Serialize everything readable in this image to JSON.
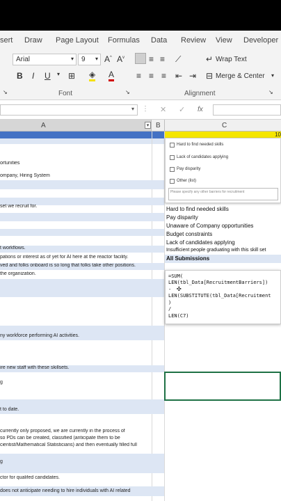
{
  "ribbon": {
    "tabs": [
      "sert",
      "Draw",
      "Page Layout",
      "Formulas",
      "Data",
      "Review",
      "View",
      "Developer"
    ],
    "font_name": "Arial",
    "font_size": "9",
    "wrap_text": "Wrap Text",
    "merge_center": "Merge & Center",
    "group_font": "Font",
    "group_alignment": "Alignment"
  },
  "formula_bar": {
    "fx": "fx"
  },
  "columns": {
    "a": "A",
    "b": "B",
    "c": "C",
    "c_frag": "10"
  },
  "col_a_rows": [
    "",
    "ortunities",
    "ompany, Hiring System",
    "",
    "",
    "",
    "set we recruit for.",
    "",
    "",
    "",
    "",
    "t workflows.",
    "pations or interest as of yet for AI here at the reactor facility.",
    "ved and folks onboard is so long that folks take other positions.",
    " the organization.",
    "",
    "",
    "ny workforce performing AI activities.",
    "",
    "ire new staff with these skillsets.",
    "g",
    "",
    "t to date.",
    "currently only proposed, we are currently in the process of",
    "so PDs can be created, classified (anticipate them to be",
    "cientist/Mathematical Statisticians) and then eventually filled full",
    "g",
    "ctor for qualifed candidates.",
    " does not anticipate needing to hire individuals with AI related"
  ],
  "checkbox_form": {
    "options": [
      "Hard to find needed skills",
      "Lack of candidates applying",
      "Pay disparity",
      "Other (list)"
    ],
    "placeholder": "Please specify any other barriers for recruitment"
  },
  "col_c_values": [
    "Hard to find needed skills",
    "Pay disparity",
    "Unaware of Company opportunities",
    "Budget constraints",
    "Lack of candidates applying",
    "Insufficient people graduating with this skill set"
  ],
  "all_submissions": "All Submissions",
  "formula_lines": [
    "=SUM(",
    "  LEN(tbl_Data[RecruitmentBarriers])",
    "  -",
    "  LEN(SUBSTITUTE(tbl_Data[Recruitment",
    ")",
    "/",
    "LEN(C7)"
  ]
}
